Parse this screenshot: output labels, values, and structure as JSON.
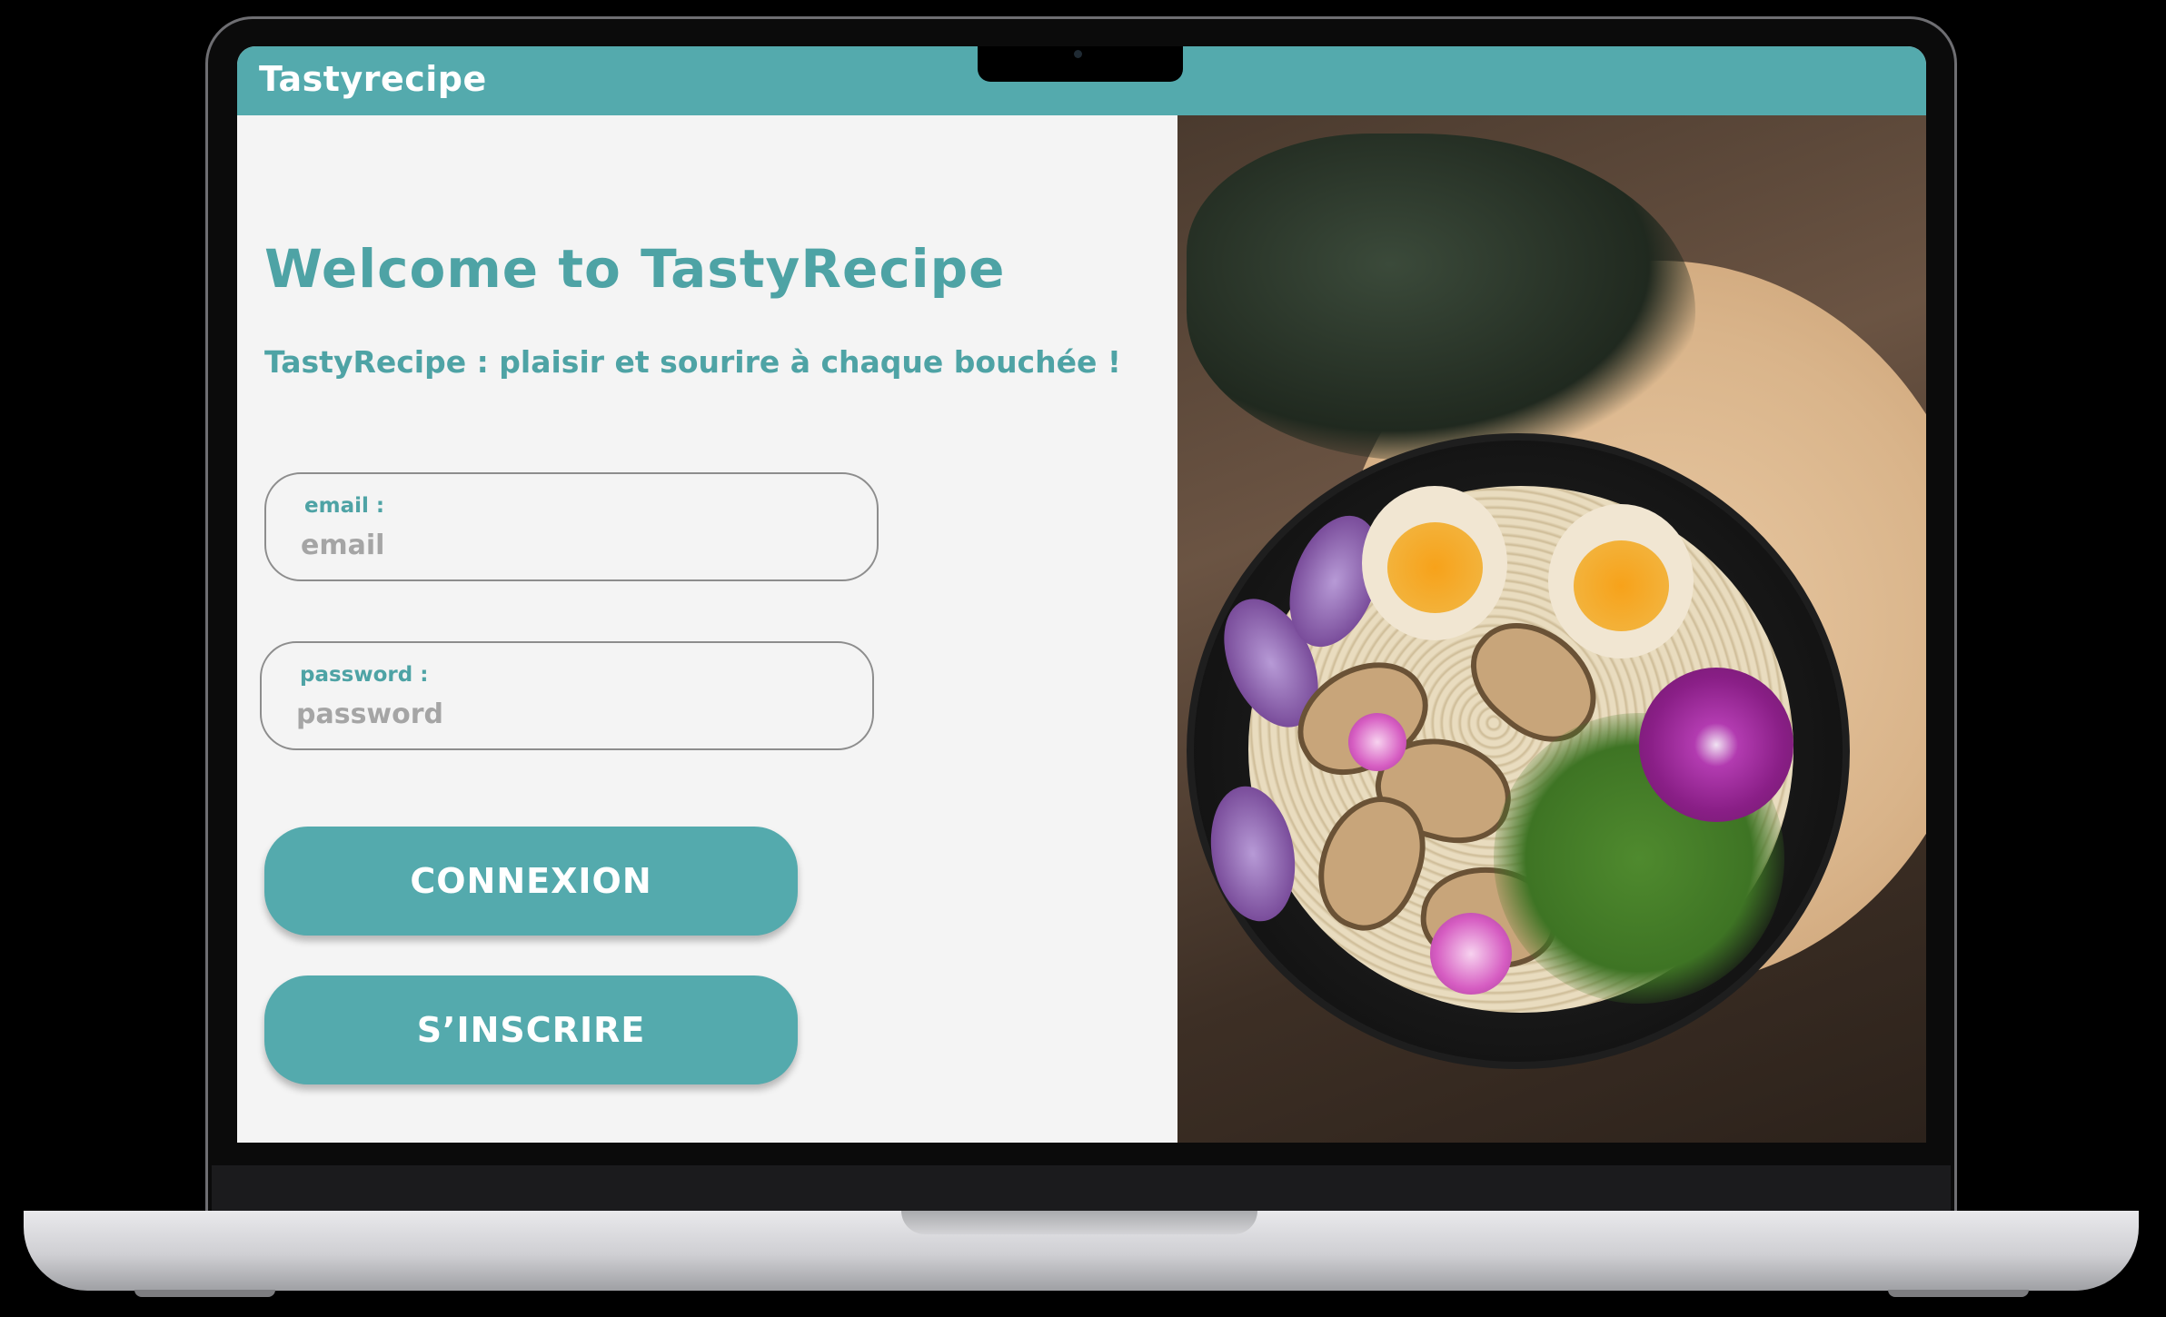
{
  "app": {
    "title": "Tastyrecipe"
  },
  "login": {
    "welcome": "Welcome to TastyRecipe",
    "tagline": "TastyRecipe : plaisir et sourire à chaque bouchée !",
    "email": {
      "label": "email :",
      "placeholder": "email",
      "value": ""
    },
    "password": {
      "label": "password :",
      "placeholder": "password",
      "value": ""
    },
    "connexion_label": "CONNEXION",
    "signup_label": "S’INSCRIRE"
  },
  "hero_image": {
    "subject": "ramen bowl with soft-boiled eggs, mushrooms, greens and edible flowers"
  },
  "colors": {
    "accent": "#54aaad",
    "accent_text": "#4ea3a5",
    "panel_background": "#f4f4f4",
    "button_text": "#ffffff",
    "placeholder": "#a5a5a5"
  }
}
